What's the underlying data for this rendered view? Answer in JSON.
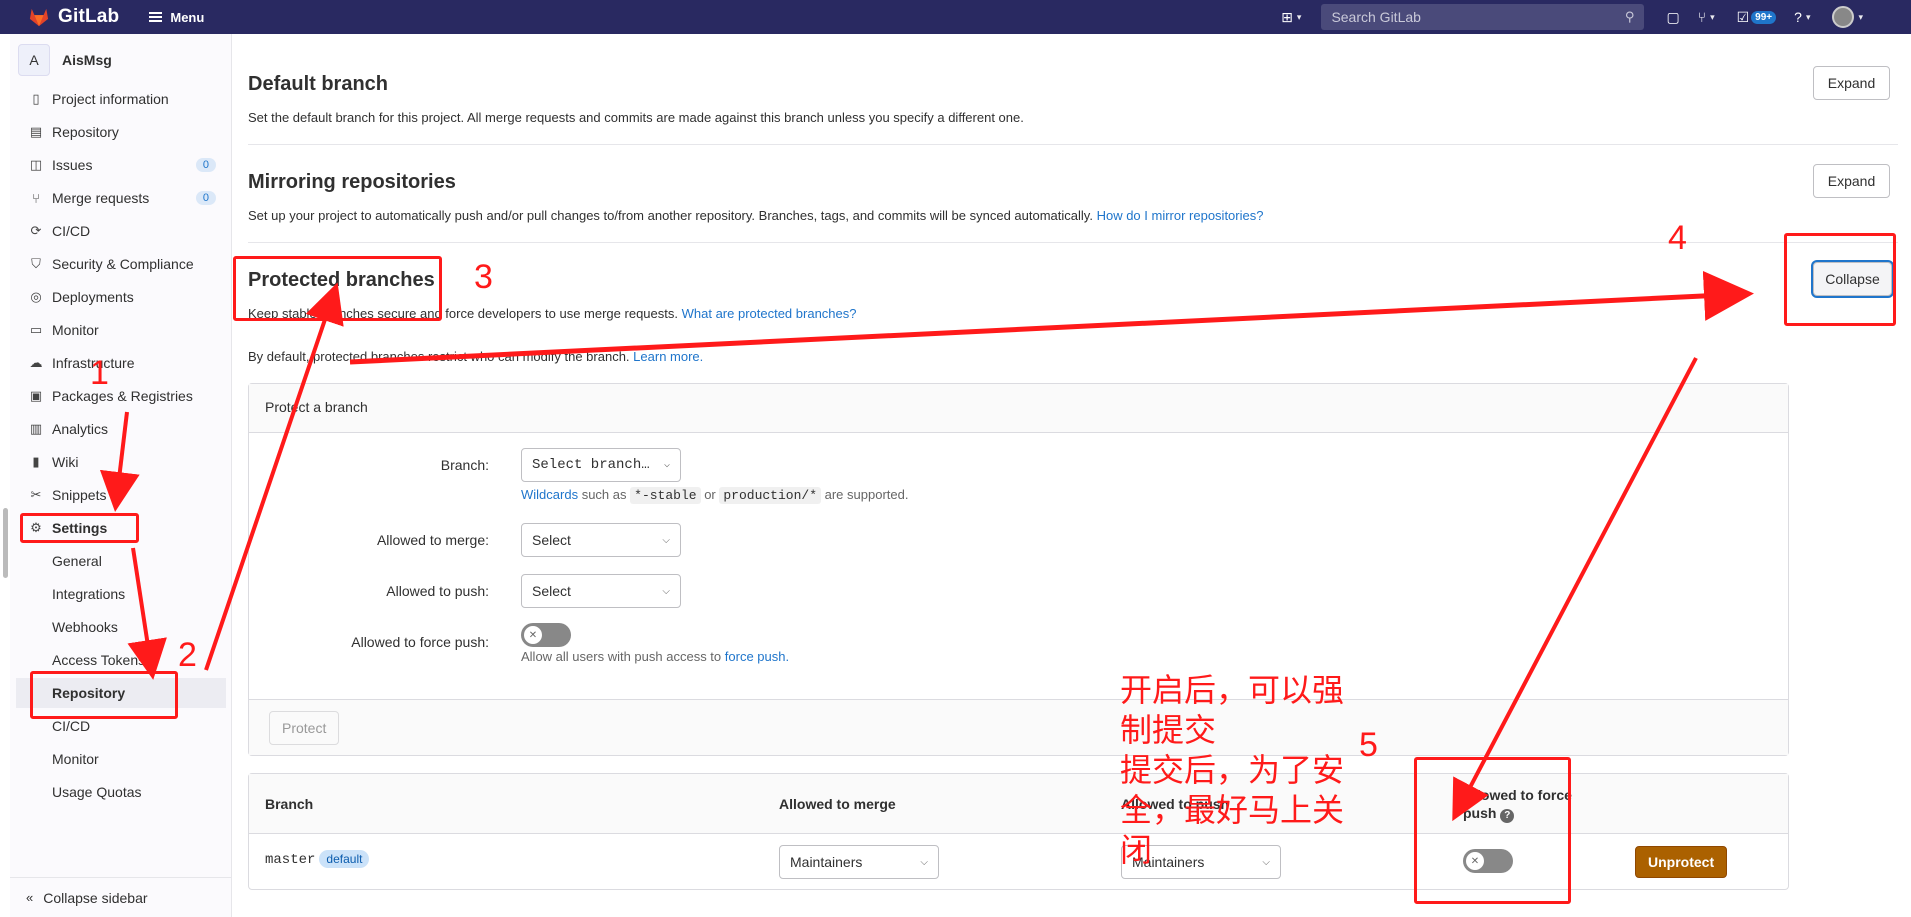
{
  "navbar": {
    "brand": "GitLab",
    "menu_label": "Menu",
    "search_placeholder": "Search GitLab",
    "todo_count": "99+"
  },
  "sidebar": {
    "project_initial": "A",
    "project_name": "AisMsg",
    "items": [
      {
        "label": "Project information",
        "icon": "info-icon"
      },
      {
        "label": "Repository",
        "icon": "book-icon"
      },
      {
        "label": "Issues",
        "icon": "issues-icon",
        "count": "0"
      },
      {
        "label": "Merge requests",
        "icon": "merge-request-icon",
        "count": "0"
      },
      {
        "label": "CI/CD",
        "icon": "rocket-icon"
      },
      {
        "label": "Security & Compliance",
        "icon": "shield-icon"
      },
      {
        "label": "Deployments",
        "icon": "deployments-icon"
      },
      {
        "label": "Monitor",
        "icon": "monitor-icon"
      },
      {
        "label": "Infrastructure",
        "icon": "cloud-icon"
      },
      {
        "label": "Packages & Registries",
        "icon": "package-icon"
      },
      {
        "label": "Analytics",
        "icon": "chart-icon"
      },
      {
        "label": "Wiki",
        "icon": "wiki-icon"
      },
      {
        "label": "Snippets",
        "icon": "scissors-icon"
      },
      {
        "label": "Settings",
        "icon": "gear-icon"
      }
    ],
    "settings_sub": [
      "General",
      "Integrations",
      "Webhooks",
      "Access Tokens",
      "Repository",
      "CI/CD",
      "Monitor",
      "Usage Quotas"
    ],
    "collapse_label": "Collapse sidebar"
  },
  "main": {
    "default_branch": {
      "title": "Default branch",
      "description": "Set the default branch for this project. All merge requests and commits are made against this branch unless you specify a different one.",
      "button": "Expand"
    },
    "mirroring": {
      "title": "Mirroring repositories",
      "description": "Set up your project to automatically push and/or pull changes to/from another repository. Branches, tags, and commits will be synced automatically.",
      "link": "How do I mirror repositories?",
      "button": "Expand"
    },
    "protected": {
      "title": "Protected branches",
      "description": "Keep stable branches secure and force developers to use merge requests.",
      "link": "What are protected branches?",
      "default_note": "By default, protected branches restrict who can modify the branch.",
      "learn_more": "Learn more.",
      "button": "Collapse"
    },
    "protect_form": {
      "header": "Protect a branch",
      "branch_label": "Branch:",
      "branch_placeholder": "Select branch…",
      "wildcards_link": "Wildcards",
      "wildcards_such_as": "such as",
      "wildcard_1": "*-stable",
      "wildcard_or": "or",
      "wildcard_2": "production/*",
      "wildcard_supported": "are supported.",
      "merge_label": "Allowed to merge:",
      "merge_value": "Select",
      "push_label": "Allowed to push:",
      "push_value": "Select",
      "force_label": "Allowed to force push:",
      "force_help": "Allow all users with push access to",
      "force_link": "force push.",
      "protect_button": "Protect"
    },
    "table": {
      "headers": [
        "Branch",
        "Allowed to merge",
        "Allowed to push",
        "Allowed to force push"
      ],
      "rows": [
        {
          "branch": "master",
          "badge": "default",
          "merge": "Maintainers",
          "push": "Maintainers",
          "action": "Unprotect"
        }
      ]
    }
  },
  "annotations": {
    "numbers": [
      "1",
      "2",
      "3",
      "4",
      "5"
    ],
    "note": "开启后，可以强制提交\n提交后，为了安全，最好马上关闭",
    "color": "#ff1a1a"
  }
}
